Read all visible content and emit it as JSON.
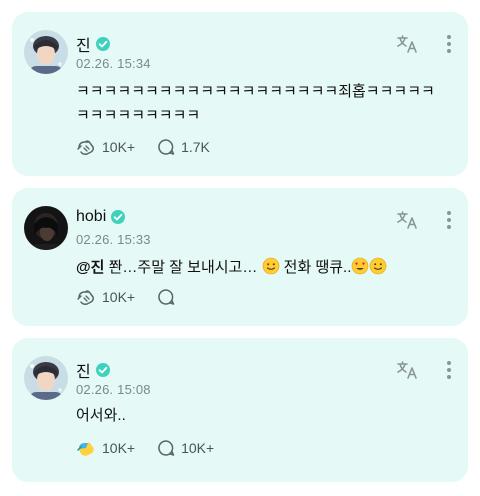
{
  "posts": [
    {
      "author": "진",
      "time": "02.26. 15:34",
      "text": "ㅋㅋㅋㅋㅋㅋㅋㅋㅋㅋㅋㅋㅋㅋㅋㅋㅋㅋㅋ죄홉ㅋㅋㅋㅋㅋㅋㅋㅋㅋㅋㅋㅋㅋㅋ",
      "likes": "10K+",
      "comments": "1.7K"
    },
    {
      "author": "hobi",
      "time": "02.26. 15:33",
      "mention": "@진",
      "text_part1": " 쫜…주말 잘 보내시고… ",
      "text_part2": " 전화 땡큐..",
      "likes": "10K+",
      "comments": ""
    },
    {
      "author": "진",
      "time": "02.26. 15:08",
      "text": "어서와..",
      "likes": "10K+",
      "comments": "10K+"
    }
  ],
  "icons": {
    "verified": "verified-badge-icon",
    "translate": "translate-icon",
    "more": "more-vertical-icon",
    "like": "like-hands-icon",
    "comment": "comment-bubble-icon"
  },
  "colors": {
    "card_background": "#e5f9f6",
    "verified": "#3fd1bd",
    "meta_text": "#7a8a88"
  }
}
